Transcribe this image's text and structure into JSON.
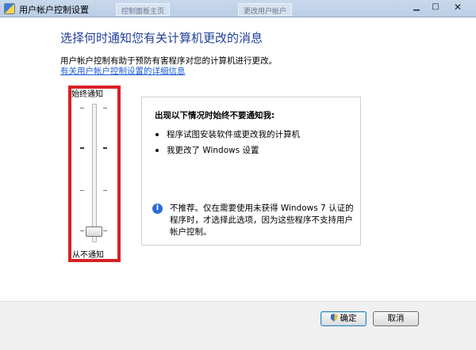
{
  "window": {
    "title": "用户帐户控制设置",
    "background_tabs": [
      "控制面板主页",
      "更改用户帐户"
    ],
    "controls": {
      "minimize": "▁",
      "maximize": "□",
      "close": "✕"
    }
  },
  "main": {
    "heading": "选择何时通知您有关计算机更改的消息",
    "description": "用户帐户控制有助于预防有害程序对您的计算机进行更改。",
    "link_text": "有关用户帐户控制设置的详细信息"
  },
  "slider": {
    "top_label": "始终通知",
    "bottom_label": "从不通知",
    "levels": 4,
    "selected_level": 1
  },
  "info": {
    "title": "出现以下情况时始终不要通知我:",
    "bullets": [
      "程序试图安装软件或更改我的计算机",
      "我更改了 Windows 设置"
    ],
    "note": "不推荐。仅在需要使用未获得 Windows 7 认证的程序时，才选择此选项，因为这些程序不支持用户帐户控制。"
  },
  "buttons": {
    "ok": "确定",
    "cancel": "取消"
  },
  "colors": {
    "heading": "#1f3e99",
    "link": "#1a5bd6",
    "highlight_frame": "#d81f26"
  },
  "icons": {
    "title": "uac-shield-icon",
    "info": "info-icon",
    "ok_button": "uac-shield-icon"
  }
}
